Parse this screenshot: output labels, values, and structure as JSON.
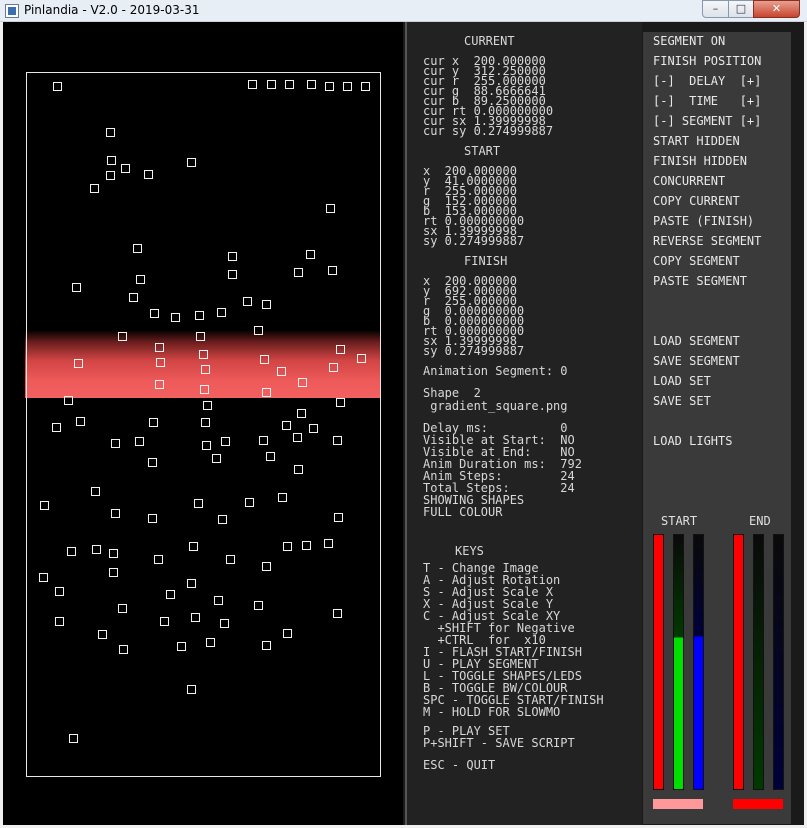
{
  "window": {
    "title": "Pinlandia - V2.0 - 2019-03-31",
    "minimize": "–",
    "maximize": "□",
    "close": "✕"
  },
  "current": {
    "heading": "CURRENT",
    "lines": [
      "cur x  200.000000",
      "cur y  312.250000",
      "cur r  255.000000",
      "cur g  88.6666641",
      "cur b  89.2500000",
      "cur rt 0.000000000",
      "cur sx 1.39999998",
      "cur sy 0.274999887"
    ]
  },
  "start": {
    "heading": "START",
    "lines": [
      "x  200.000000",
      "y  41.0000000",
      "r  255.000000",
      "g  152.000000",
      "b  153.000000",
      "rt 0.000000000",
      "sx 1.39999998",
      "sy 0.274999887"
    ]
  },
  "finish": {
    "heading": "FINISH",
    "lines": [
      "x  200.000000",
      "y  692.000000",
      "r  255.000000",
      "g  0.000000000",
      "b  0.000000000",
      "rt 0.000000000",
      "sx 1.39999998",
      "sy 0.274999887"
    ]
  },
  "segment": {
    "animation_segment": "Animation Segment: 0",
    "shape": "Shape  2",
    "file": " gradient_square.png"
  },
  "timing": {
    "lines": [
      "Delay ms:          0",
      "Visible at Start:  NO",
      "Visible at End:    NO",
      "Anim Duration ms:  792",
      "Anim Steps:        24",
      "Total Steps:       24",
      "SHOWING SHAPES",
      "FULL COLOUR"
    ]
  },
  "keys": {
    "heading": "KEYS",
    "lines": [
      "T - Change Image",
      "A - Adjust Rotation",
      "S - Adjust Scale X",
      "X - Adjust Scale Y",
      "C - Adjust Scale XY",
      "  +SHIFT for Negative",
      "  +CTRL  for  x10",
      "I - FLASH START/FINISH",
      "U - PLAY SEGMENT",
      "L - TOGGLE SHAPES/LEDS",
      "B - TOGGLE BW/COLOUR",
      "SPC - TOGGLE START/FINISH",
      "M - HOLD FOR SLOWMO"
    ],
    "play_set": "P - PLAY SET",
    "save_script": "P+SHIFT - SAVE SCRIPT",
    "quit": "ESC - QUIT"
  },
  "buttons": {
    "segment_on": "SEGMENT ON",
    "finish_position": "FINISH POSITION",
    "delay": "[-]  DELAY  [+]",
    "time": "[-]  TIME   [+]",
    "segment": "[-] SEGMENT [+]",
    "start_hidden": "START HIDDEN",
    "finish_hidden": "FINISH HIDDEN",
    "concurrent": "CONCURRENT",
    "copy_current": "COPY CURRENT",
    "paste_finish": "PASTE (FINISH)",
    "reverse_segment": "REVERSE SEGMENT",
    "copy_segment": "COPY SEGMENT",
    "paste_segment": "PASTE SEGMENT",
    "load_segment": "LOAD SEGMENT",
    "save_segment": "SAVE SEGMENT",
    "load_set": "LOAD SET",
    "save_set": "SAVE SET",
    "load_lights": "LOAD LIGHTS"
  },
  "meters": {
    "start_label": "START",
    "end_label": "END",
    "start": {
      "r": 255,
      "g": 152,
      "b": 153
    },
    "end": {
      "r": 255,
      "g": 0,
      "b": 0
    },
    "start_swatch": "#ff9899",
    "end_swatch": "#ff0000"
  }
}
